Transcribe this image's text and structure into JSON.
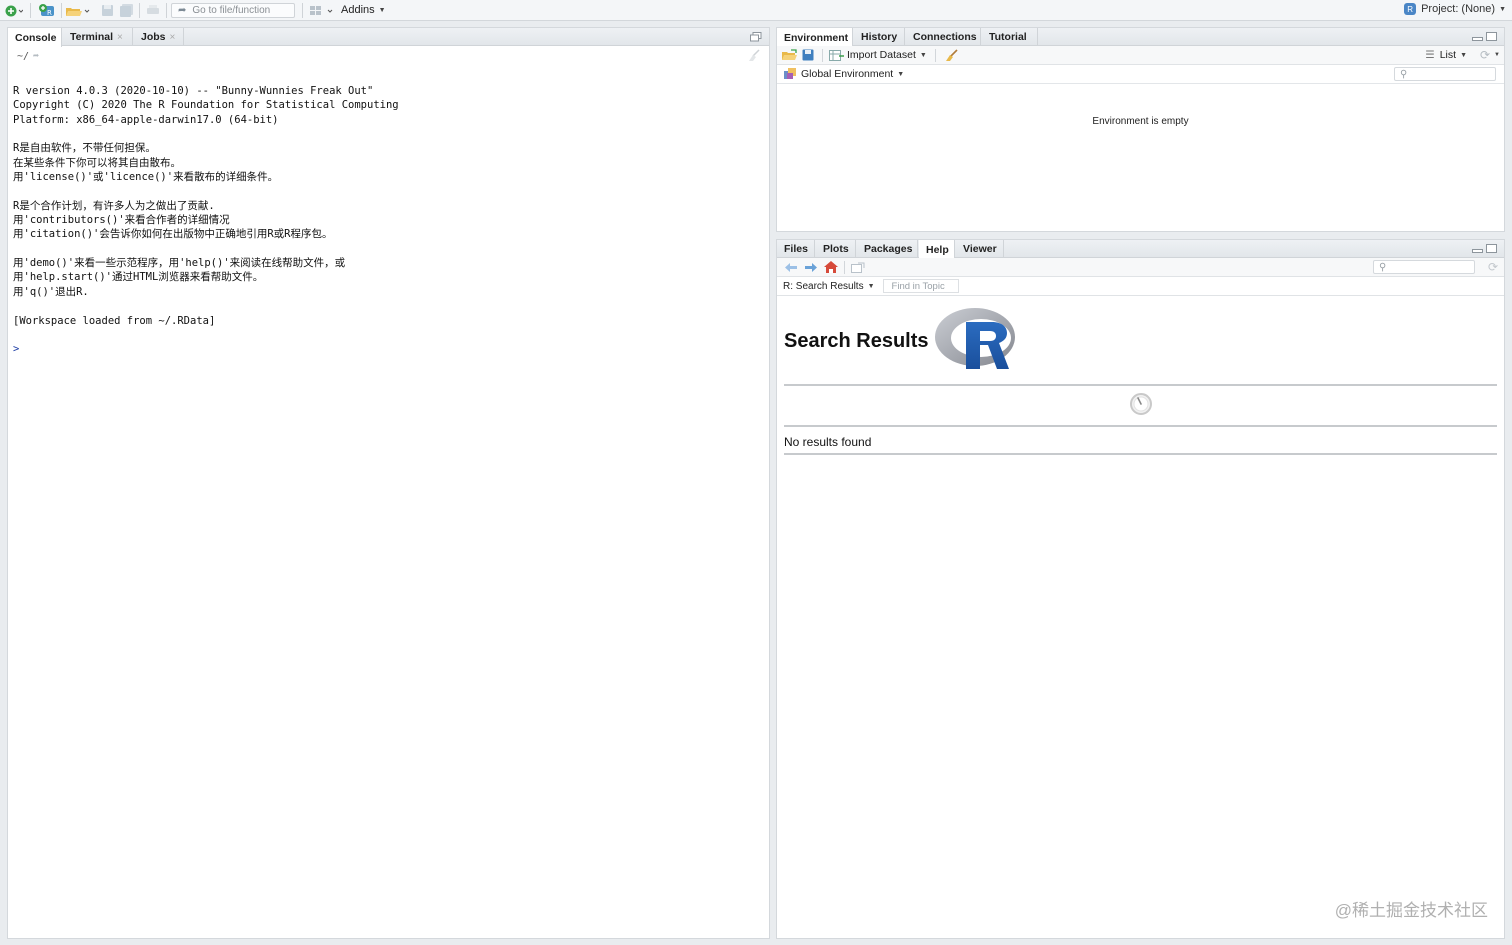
{
  "toolbar": {
    "goto_placeholder": "Go to file/function",
    "addins_label": "Addins",
    "project_label": "Project: (None)"
  },
  "console_pane": {
    "tabs": [
      {
        "label": "Console"
      },
      {
        "label": "Terminal"
      },
      {
        "label": "Jobs"
      }
    ],
    "path": "~/",
    "output_lines": [
      "R version 4.0.3 (2020-10-10) -- \"Bunny-Wunnies Freak Out\"",
      "Copyright (C) 2020 The R Foundation for Statistical Computing",
      "Platform: x86_64-apple-darwin17.0 (64-bit)",
      "",
      "R是自由软件，不带任何担保。",
      "在某些条件下你可以将其自由散布。",
      "用'license()'或'licence()'来看散布的详细条件。",
      "",
      "R是个合作计划，有许多人为之做出了贡献.",
      "用'contributors()'来看合作者的详细情况",
      "用'citation()'会告诉你如何在出版物中正确地引用R或R程序包。",
      "",
      "用'demo()'来看一些示范程序，用'help()'来阅读在线帮助文件，或",
      "用'help.start()'通过HTML浏览器来看帮助文件。",
      "用'q()'退出R.",
      "",
      "[Workspace loaded from ~/.RData]",
      ""
    ],
    "prompt": ">"
  },
  "env_pane": {
    "tabs": [
      {
        "label": "Environment"
      },
      {
        "label": "History"
      },
      {
        "label": "Connections"
      },
      {
        "label": "Tutorial"
      }
    ],
    "import_dataset_label": "Import Dataset",
    "list_label": "List",
    "scope_label": "Global Environment",
    "empty_message": "Environment is empty"
  },
  "help_pane": {
    "tabs": [
      {
        "label": "Files"
      },
      {
        "label": "Plots"
      },
      {
        "label": "Packages"
      },
      {
        "label": "Help"
      },
      {
        "label": "Viewer"
      }
    ],
    "topic_label": "R: Search Results",
    "find_placeholder": "Find in Topic",
    "title": "Search Results",
    "no_results": "No results found"
  },
  "watermark": "@稀土掘金技术社区",
  "colors": {
    "accent_blue": "#1f66b5",
    "toolbar_bg": "#f4f6f8",
    "tab_bg": "#e6e9ec"
  }
}
